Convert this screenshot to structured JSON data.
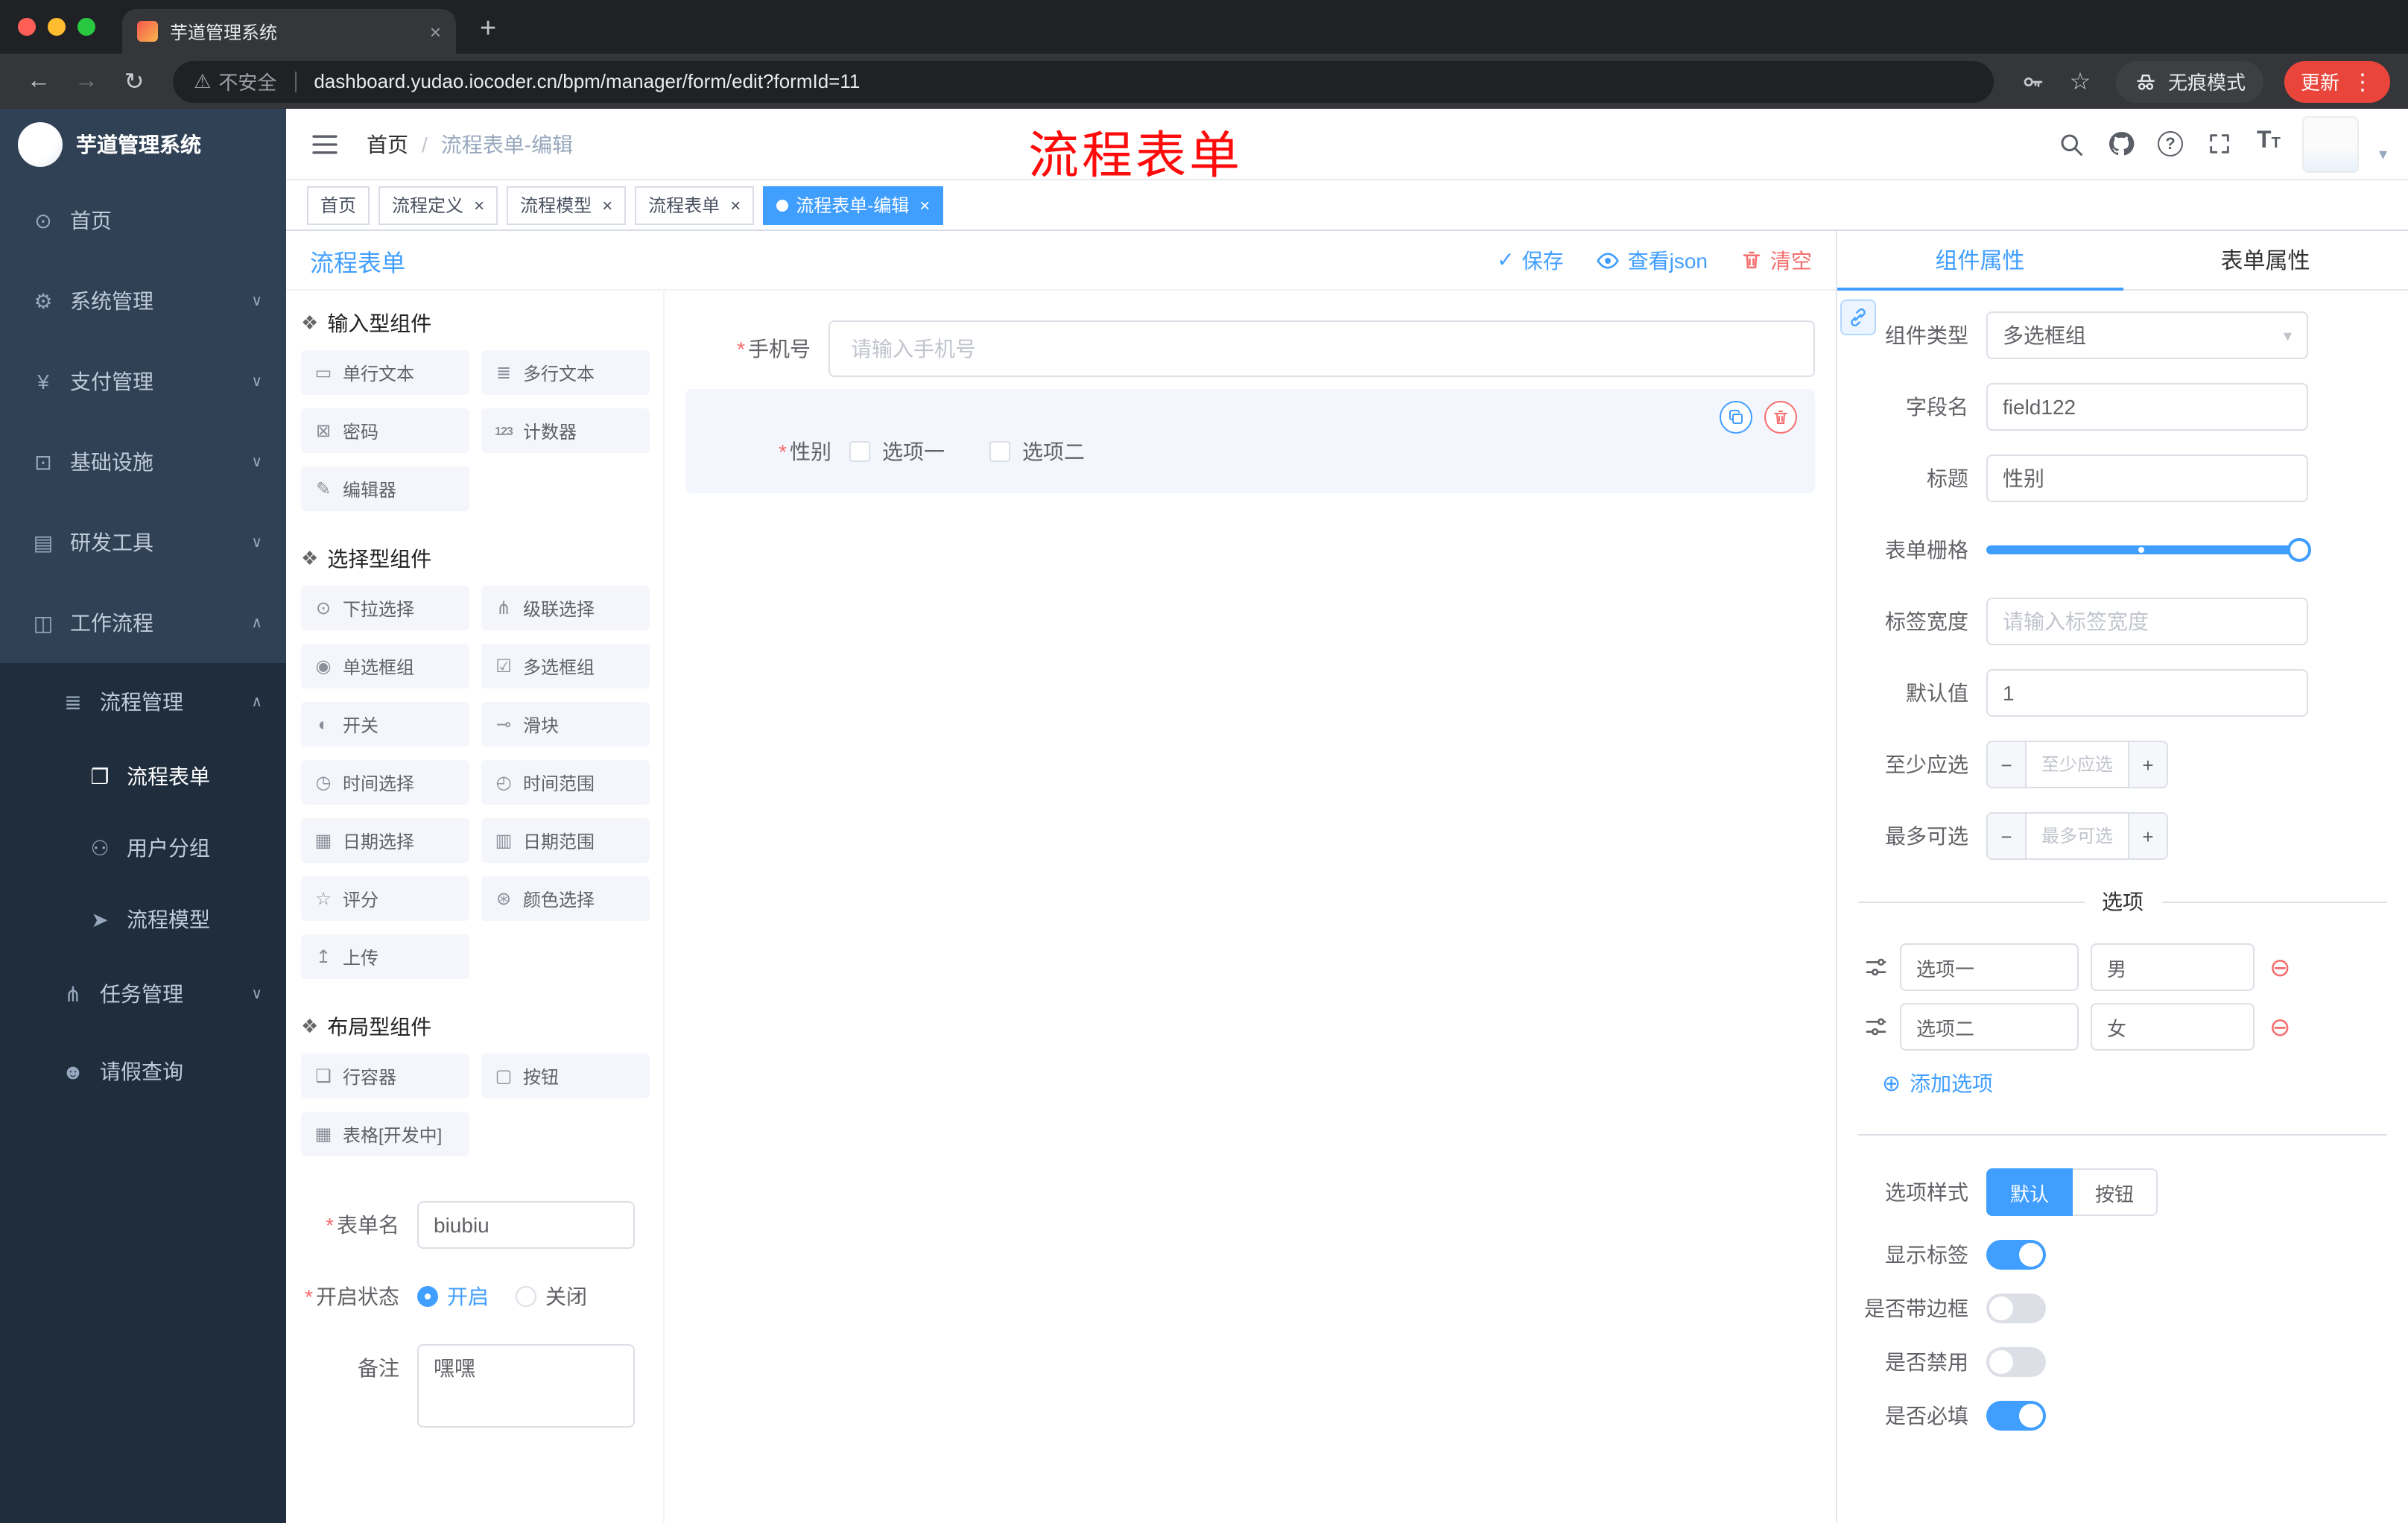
{
  "colors": {
    "primary": "#409eff",
    "danger": "#f56c6c",
    "sidebar_bg": "#304156",
    "sidebar_submenu_bg": "#1f2d3d",
    "annotation_red": "#fe0b0b",
    "active_tag_bg": "#409eff"
  },
  "ui": {
    "required_mark": "*",
    "close": "×",
    "plus": "+",
    "minus": "−",
    "check": "✓",
    "chevron_down": "∨",
    "chevron_up": "∧",
    "select_caret": "▾",
    "nav_caret": "▾",
    "back": "←",
    "forward": "→",
    "reload": "↻",
    "warning": "⚠",
    "star": "☆",
    "menu": "⋮",
    "new_tab": "+",
    "add_circle": "⊕",
    "remove_circle": "⊖",
    "question": "?",
    "font_big": "T",
    "font_small": "T"
  },
  "browser": {
    "tab_title": "芋道管理系统",
    "not_secure": "不安全",
    "url": "dashboard.yudao.iocoder.cn/bpm/manager/form/edit?formId=11",
    "incognito_label": "无痕模式",
    "update_label": "更新"
  },
  "sidebar": {
    "title": "芋道管理系统",
    "items": [
      {
        "label": "首页",
        "icon": "⊙"
      },
      {
        "label": "系统管理",
        "icon": "⚙"
      },
      {
        "label": "支付管理",
        "icon": "¥"
      },
      {
        "label": "基础设施",
        "icon": "⊡"
      },
      {
        "label": "研发工具",
        "icon": "▤"
      },
      {
        "label": "工作流程",
        "icon": "◫"
      },
      {
        "label": "流程管理",
        "icon": "≣"
      },
      {
        "label": "流程表单",
        "icon": "❐"
      },
      {
        "label": "用户分组",
        "icon": "⚇"
      },
      {
        "label": "流程模型",
        "icon": "➤"
      },
      {
        "label": "任务管理",
        "icon": "⋔"
      },
      {
        "label": "请假查询",
        "icon": "☻"
      }
    ]
  },
  "header": {
    "breadcrumb_root": "首页",
    "breadcrumb_sep": "/",
    "breadcrumb_current": "流程表单-编辑",
    "annotation": "流程表单"
  },
  "tags": [
    {
      "label": "首页"
    },
    {
      "label": "流程定义"
    },
    {
      "label": "流程模型"
    },
    {
      "label": "流程表单"
    },
    {
      "label": "流程表单-编辑"
    }
  ],
  "designer": {
    "title": "流程表单",
    "actions": {
      "save": "保存",
      "view_json": "查看json",
      "clear": "清空"
    },
    "palette": {
      "sections": [
        {
          "title": "输入型组件",
          "items": [
            {
              "label": "单行文本",
              "icon": "▭"
            },
            {
              "label": "多行文本",
              "icon": "≣"
            },
            {
              "label": "密码",
              "icon": "⊠"
            },
            {
              "label": "计数器",
              "icon": "123"
            },
            {
              "label": "编辑器",
              "icon": "✎"
            }
          ]
        },
        {
          "title": "选择型组件",
          "items": [
            {
              "label": "下拉选择",
              "icon": "⊙"
            },
            {
              "label": "级联选择",
              "icon": "⋔"
            },
            {
              "label": "单选框组",
              "icon": "◉"
            },
            {
              "label": "多选框组",
              "icon": "☑"
            },
            {
              "label": "开关",
              "icon": "◐"
            },
            {
              "label": "滑块",
              "icon": "⊸"
            },
            {
              "label": "时间选择",
              "icon": "◷"
            },
            {
              "label": "时间范围",
              "icon": "◴"
            },
            {
              "label": "日期选择",
              "icon": "▦"
            },
            {
              "label": "日期范围",
              "icon": "▥"
            },
            {
              "label": "评分",
              "icon": "☆"
            },
            {
              "label": "颜色选择",
              "icon": "⊛"
            },
            {
              "label": "上传",
              "icon": "↥"
            }
          ]
        },
        {
          "title": "布局型组件",
          "items": [
            {
              "label": "行容器",
              "icon": "❏"
            },
            {
              "label": "按钮",
              "icon": "▢"
            },
            {
              "label": "表格[开发中]",
              "icon": "▦"
            }
          ]
        }
      ]
    },
    "meta_form": {
      "name_label": "表单名",
      "name_value": "biubiu",
      "status_label": "开启状态",
      "status_on": "开启",
      "status_off": "关闭",
      "remark_label": "备注",
      "remark_value": "嘿嘿"
    },
    "canvas": {
      "phone_label": "手机号",
      "phone_placeholder": "请输入手机号",
      "gender_label": "性别",
      "gender_option1": "选项一",
      "gender_option2": "选项二"
    }
  },
  "props": {
    "tab_component": "组件属性",
    "tab_form": "表单属性",
    "component_type_label": "组件类型",
    "component_type_value": "多选框组",
    "field_name_label": "字段名",
    "field_name_value": "field122",
    "title_label": "标题",
    "title_value": "性别",
    "grid_label": "表单栅格",
    "label_width_label": "标签宽度",
    "label_width_placeholder": "请输入标签宽度",
    "default_label": "默认值",
    "default_value": "1",
    "min_label": "至少应选",
    "min_placeholder": "至少应选",
    "max_label": "最多可选",
    "max_placeholder": "最多可选",
    "options_title": "选项",
    "options": [
      {
        "label": "选项一",
        "value": "男"
      },
      {
        "label": "选项二",
        "value": "女"
      }
    ],
    "add_option": "添加选项",
    "style_label": "选项样式",
    "style_default": "默认",
    "style_button": "按钮",
    "show_label": "显示标签",
    "border_label": "是否带边框",
    "disabled_label": "是否禁用",
    "required_label": "是否必填"
  }
}
